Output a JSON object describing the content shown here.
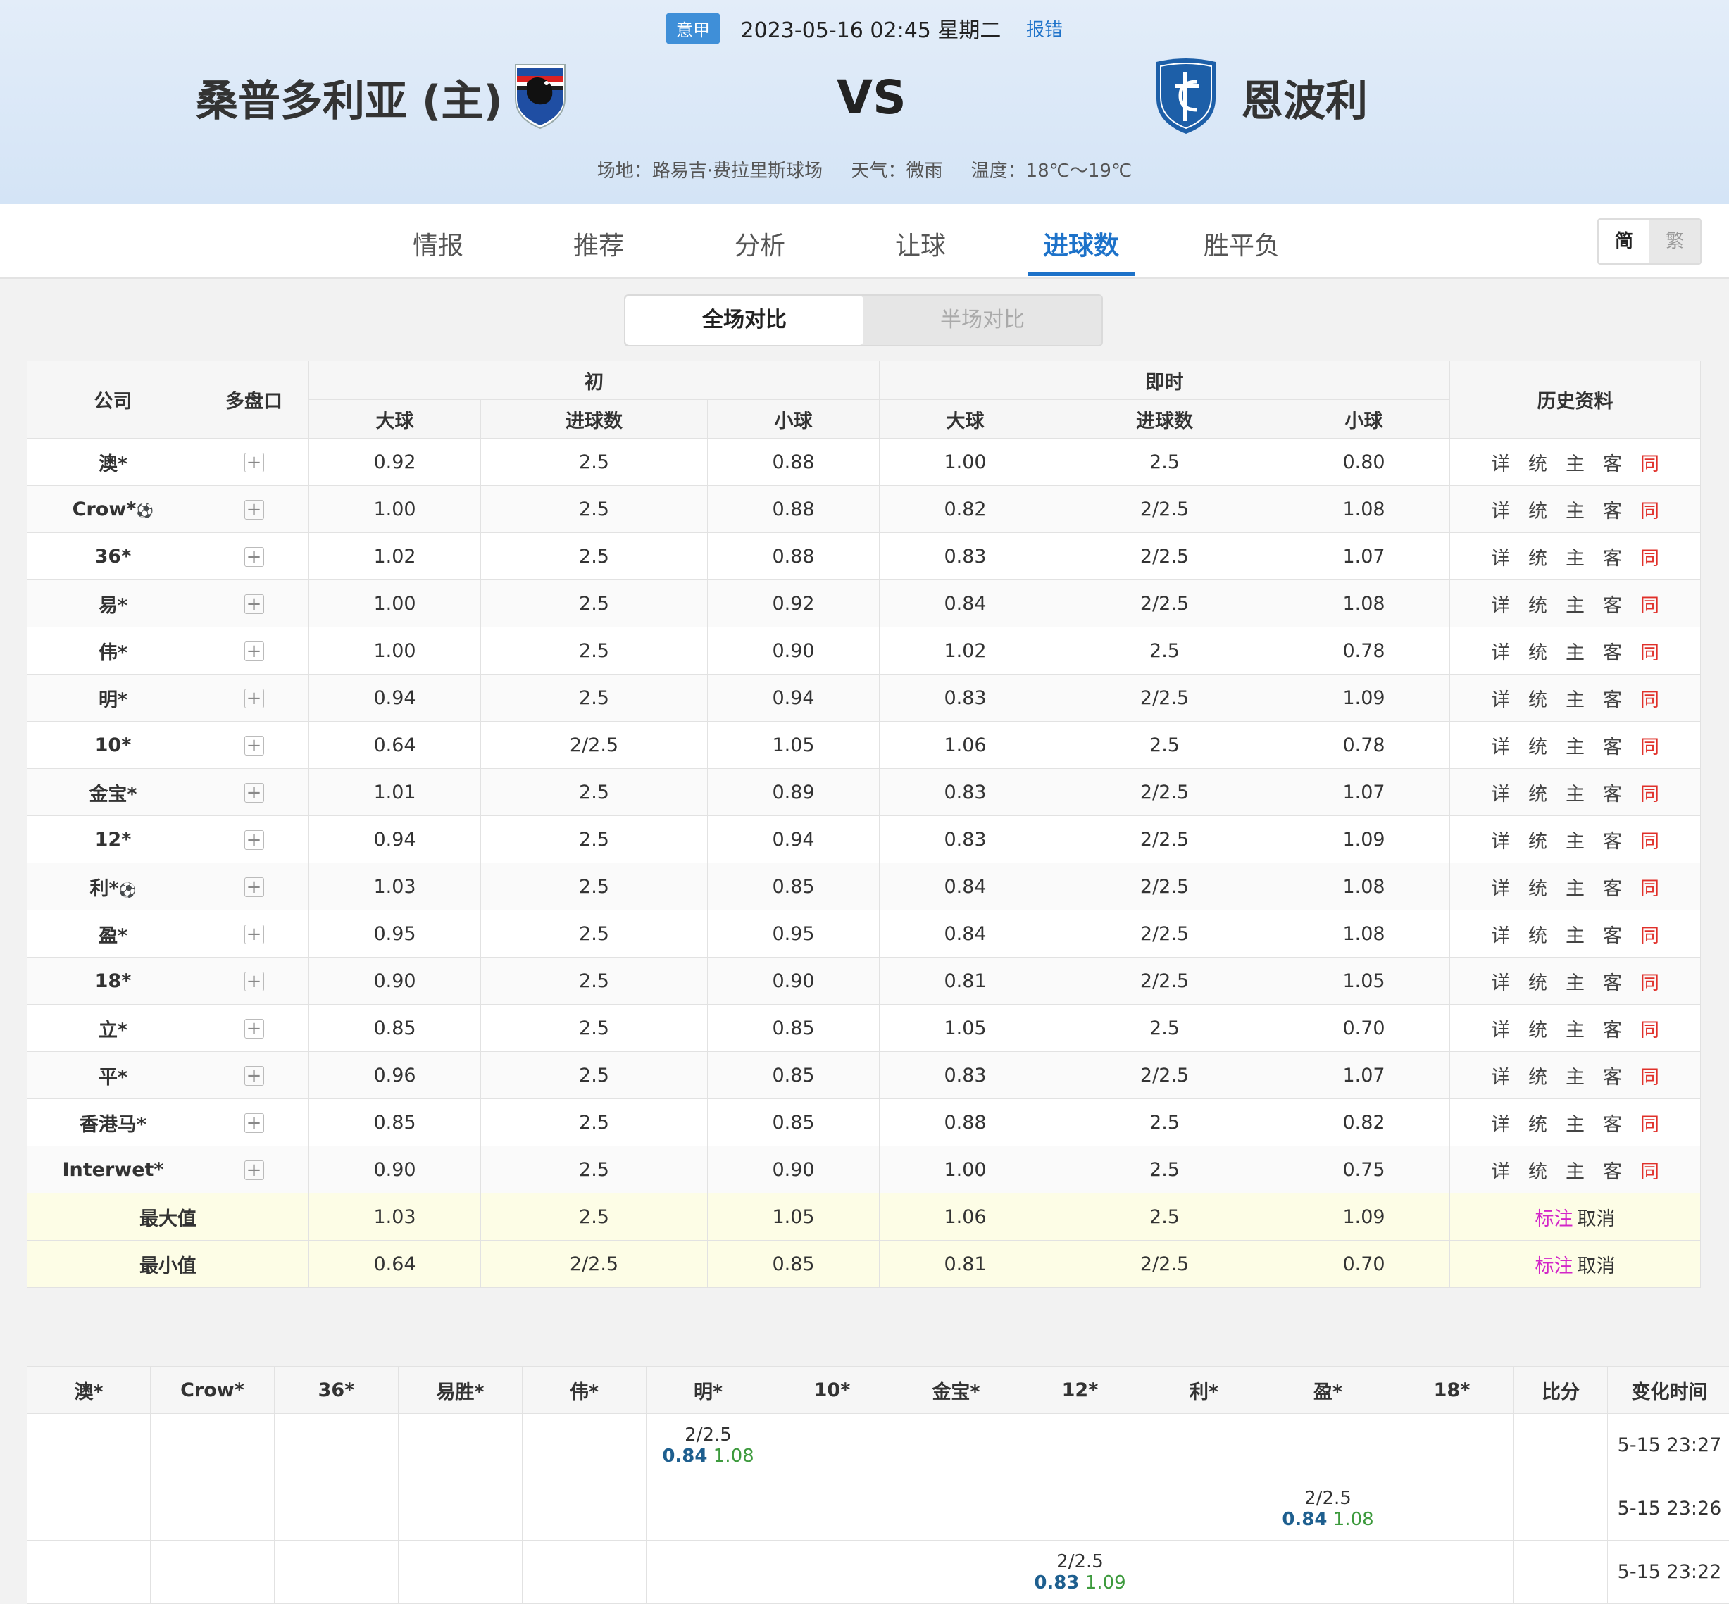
{
  "header": {
    "league": "意甲",
    "kickoff": "2023-05-16 02:45 星期二",
    "report_link": "报错",
    "home_team": "桑普多利亚 (主)",
    "vs": "VS",
    "away_team": "恩波利",
    "venue": "场地：路易吉·费拉里斯球场",
    "weather": "天气：微雨",
    "temperature": "温度：18℃～19℃"
  },
  "nav": {
    "tabs": [
      "情报",
      "推荐",
      "分析",
      "让球",
      "进球数",
      "胜平负"
    ],
    "active_tab": "进球数",
    "lang_simplified": "简",
    "lang_traditional": "繁"
  },
  "segment": {
    "full": "全场对比",
    "half": "半场对比",
    "selected": "全场对比"
  },
  "table": {
    "headers": {
      "company": "公司",
      "multi": "多盘口",
      "initial": "初",
      "live": "即时",
      "history": "历史资料",
      "over": "大球",
      "goals": "进球数",
      "under": "小球"
    },
    "rows": [
      {
        "company": "澳*",
        "ball": false,
        "i_over": "0.92",
        "i_goals": "2.5",
        "i_under": "0.88",
        "l_over": "1.00",
        "l_goals": "2.5",
        "l_under": "0.80"
      },
      {
        "company": "Crow*",
        "ball": true,
        "i_over": "1.00",
        "i_goals": "2.5",
        "i_under": "0.88",
        "l_over": "0.82",
        "l_goals": "2/2.5",
        "l_under": "1.08"
      },
      {
        "company": "36*",
        "ball": false,
        "i_over": "1.02",
        "i_goals": "2.5",
        "i_under": "0.88",
        "l_over": "0.83",
        "l_goals": "2/2.5",
        "l_under": "1.07"
      },
      {
        "company": "易*",
        "ball": false,
        "i_over": "1.00",
        "i_goals": "2.5",
        "i_under": "0.92",
        "l_over": "0.84",
        "l_goals": "2/2.5",
        "l_under": "1.08"
      },
      {
        "company": "伟*",
        "ball": false,
        "i_over": "1.00",
        "i_goals": "2.5",
        "i_under": "0.90",
        "l_over": "1.02",
        "l_goals": "2.5",
        "l_under": "0.78"
      },
      {
        "company": "明*",
        "ball": false,
        "i_over": "0.94",
        "i_goals": "2.5",
        "i_under": "0.94",
        "l_over": "0.83",
        "l_goals": "2/2.5",
        "l_under": "1.09"
      },
      {
        "company": "10*",
        "ball": false,
        "i_over": "0.64",
        "i_goals": "2/2.5",
        "i_under": "1.05",
        "l_over": "1.06",
        "l_goals": "2.5",
        "l_under": "0.78"
      },
      {
        "company": "金宝*",
        "ball": false,
        "i_over": "1.01",
        "i_goals": "2.5",
        "i_under": "0.89",
        "l_over": "0.83",
        "l_goals": "2/2.5",
        "l_under": "1.07"
      },
      {
        "company": "12*",
        "ball": false,
        "i_over": "0.94",
        "i_goals": "2.5",
        "i_under": "0.94",
        "l_over": "0.83",
        "l_goals": "2/2.5",
        "l_under": "1.09"
      },
      {
        "company": "利*",
        "ball": true,
        "i_over": "1.03",
        "i_goals": "2.5",
        "i_under": "0.85",
        "l_over": "0.84",
        "l_goals": "2/2.5",
        "l_under": "1.08"
      },
      {
        "company": "盈*",
        "ball": false,
        "i_over": "0.95",
        "i_goals": "2.5",
        "i_under": "0.95",
        "l_over": "0.84",
        "l_goals": "2/2.5",
        "l_under": "1.08"
      },
      {
        "company": "18*",
        "ball": false,
        "i_over": "0.90",
        "i_goals": "2.5",
        "i_under": "0.90",
        "l_over": "0.81",
        "l_goals": "2/2.5",
        "l_under": "1.05"
      },
      {
        "company": "立*",
        "ball": false,
        "i_over": "0.85",
        "i_goals": "2.5",
        "i_under": "0.85",
        "l_over": "1.05",
        "l_goals": "2.5",
        "l_under": "0.70"
      },
      {
        "company": "平*",
        "ball": false,
        "i_over": "0.96",
        "i_goals": "2.5",
        "i_under": "0.85",
        "l_over": "0.83",
        "l_goals": "2/2.5",
        "l_under": "1.07"
      },
      {
        "company": "香港马*",
        "ball": false,
        "i_over": "0.85",
        "i_goals": "2.5",
        "i_under": "0.85",
        "l_over": "0.88",
        "l_goals": "2.5",
        "l_under": "0.82"
      },
      {
        "company": "Interwet*",
        "ball": false,
        "i_over": "0.90",
        "i_goals": "2.5",
        "i_under": "0.90",
        "l_over": "1.00",
        "l_goals": "2.5",
        "l_under": "0.75"
      }
    ],
    "history_links": [
      "详",
      "统",
      "主",
      "客",
      "同"
    ],
    "plus": "+",
    "ball_icon": "⚽",
    "summary": [
      {
        "label": "最大值",
        "i_over": "1.03",
        "i_goals": "2.5",
        "i_under": "1.05",
        "l_over": "1.06",
        "l_goals": "2.5",
        "l_under": "1.09"
      },
      {
        "label": "最小值",
        "i_over": "0.64",
        "i_goals": "2/2.5",
        "i_under": "0.85",
        "l_over": "0.81",
        "l_goals": "2/2.5",
        "l_under": "0.70"
      }
    ],
    "mark_label": "标注",
    "cancel_label": "取消"
  },
  "changes": {
    "headers": [
      "澳*",
      "Crow*",
      "36*",
      "易胜*",
      "伟*",
      "明*",
      "10*",
      "金宝*",
      "12*",
      "利*",
      "盈*",
      "18*",
      "比分",
      "变化时间"
    ],
    "rows": [
      {
        "col": 5,
        "goals": "2/2.5",
        "over": "0.84",
        "under": "1.08",
        "time": "5-15 23:27"
      },
      {
        "col": 10,
        "goals": "2/2.5",
        "over": "0.84",
        "under": "1.08",
        "time": "5-15 23:26"
      },
      {
        "col": 8,
        "goals": "2/2.5",
        "over": "0.83",
        "under": "1.09",
        "time": "5-15 23:22"
      }
    ]
  }
}
